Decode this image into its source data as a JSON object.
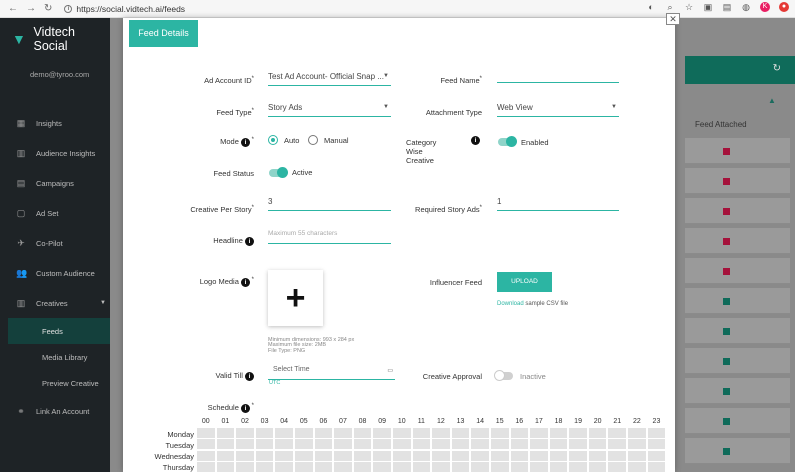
{
  "browser": {
    "url": "https://social.vidtech.ai/feeds",
    "profile_initial": "K"
  },
  "sidebar": {
    "brand": "Vidtech Social",
    "user_email": "demo@tyroo.com",
    "items": [
      {
        "label": "Insights",
        "icon": "insights-icon"
      },
      {
        "label": "Audience Insights",
        "icon": "audience-insights-icon"
      },
      {
        "label": "Campaigns",
        "icon": "campaigns-icon"
      },
      {
        "label": "Ad Set",
        "icon": "ad-set-icon"
      },
      {
        "label": "Co-Pilot",
        "icon": "co-pilot-icon"
      },
      {
        "label": "Custom Audience",
        "icon": "custom-audience-icon"
      },
      {
        "label": "Creatives",
        "icon": "creatives-icon"
      },
      {
        "label": "Feeds"
      },
      {
        "label": "Media Library"
      },
      {
        "label": "Preview Creative"
      },
      {
        "label": "Link An Account",
        "icon": "link-icon"
      }
    ]
  },
  "background": {
    "column_header": "Feed Attached"
  },
  "modal": {
    "tab": "Feed Details",
    "ad_account": {
      "label": "Ad Account ID",
      "value": "Test Ad Account- Official Snap ..."
    },
    "feed_name": {
      "label": "Feed Name",
      "value": ""
    },
    "feed_type": {
      "label": "Feed Type",
      "value": "Story Ads"
    },
    "attachment_type": {
      "label": "Attachment Type",
      "value": "Web View"
    },
    "mode": {
      "label": "Mode",
      "options": [
        "Auto",
        "Manual"
      ],
      "selected": "Auto"
    },
    "category_wise": {
      "label_line1": "Category Wise",
      "label_line2": "Creative",
      "state": "Enabled"
    },
    "feed_status": {
      "label": "Feed Status",
      "state": "Active"
    },
    "creative_per_story": {
      "label": "Creative Per Story",
      "value": "3"
    },
    "required_story_ads": {
      "label": "Required Story Ads",
      "value": "1"
    },
    "headline": {
      "label": "Headline",
      "placeholder": "Maximum 55 characters"
    },
    "logo_media": {
      "label": "Logo Media",
      "hint1": "Minimum dimensions: 993 x 284 px",
      "hint2": "Maximum file size: 2MB",
      "hint3": "File Type: PNG"
    },
    "influencer_feed": {
      "label": "Influencer Feed",
      "button": "UPLOAD",
      "download_link": "Download",
      "download_suffix": "sample CSV file"
    },
    "valid_till": {
      "label": "Valid Till",
      "placeholder": "Select Time",
      "tz": "UTC"
    },
    "creative_approval": {
      "label": "Creative Approval",
      "state": "Inactive"
    },
    "schedule": {
      "label": "Schedule",
      "hours": [
        "00",
        "01",
        "02",
        "03",
        "04",
        "05",
        "06",
        "07",
        "08",
        "09",
        "10",
        "11",
        "12",
        "13",
        "14",
        "15",
        "16",
        "17",
        "18",
        "19",
        "20",
        "21",
        "22",
        "23"
      ],
      "days": [
        "Monday",
        "Tuesday",
        "Wednesday",
        "Thursday"
      ]
    }
  },
  "colors": {
    "accent": "#2cb5a3",
    "sidebar_bg": "#1e2326"
  }
}
